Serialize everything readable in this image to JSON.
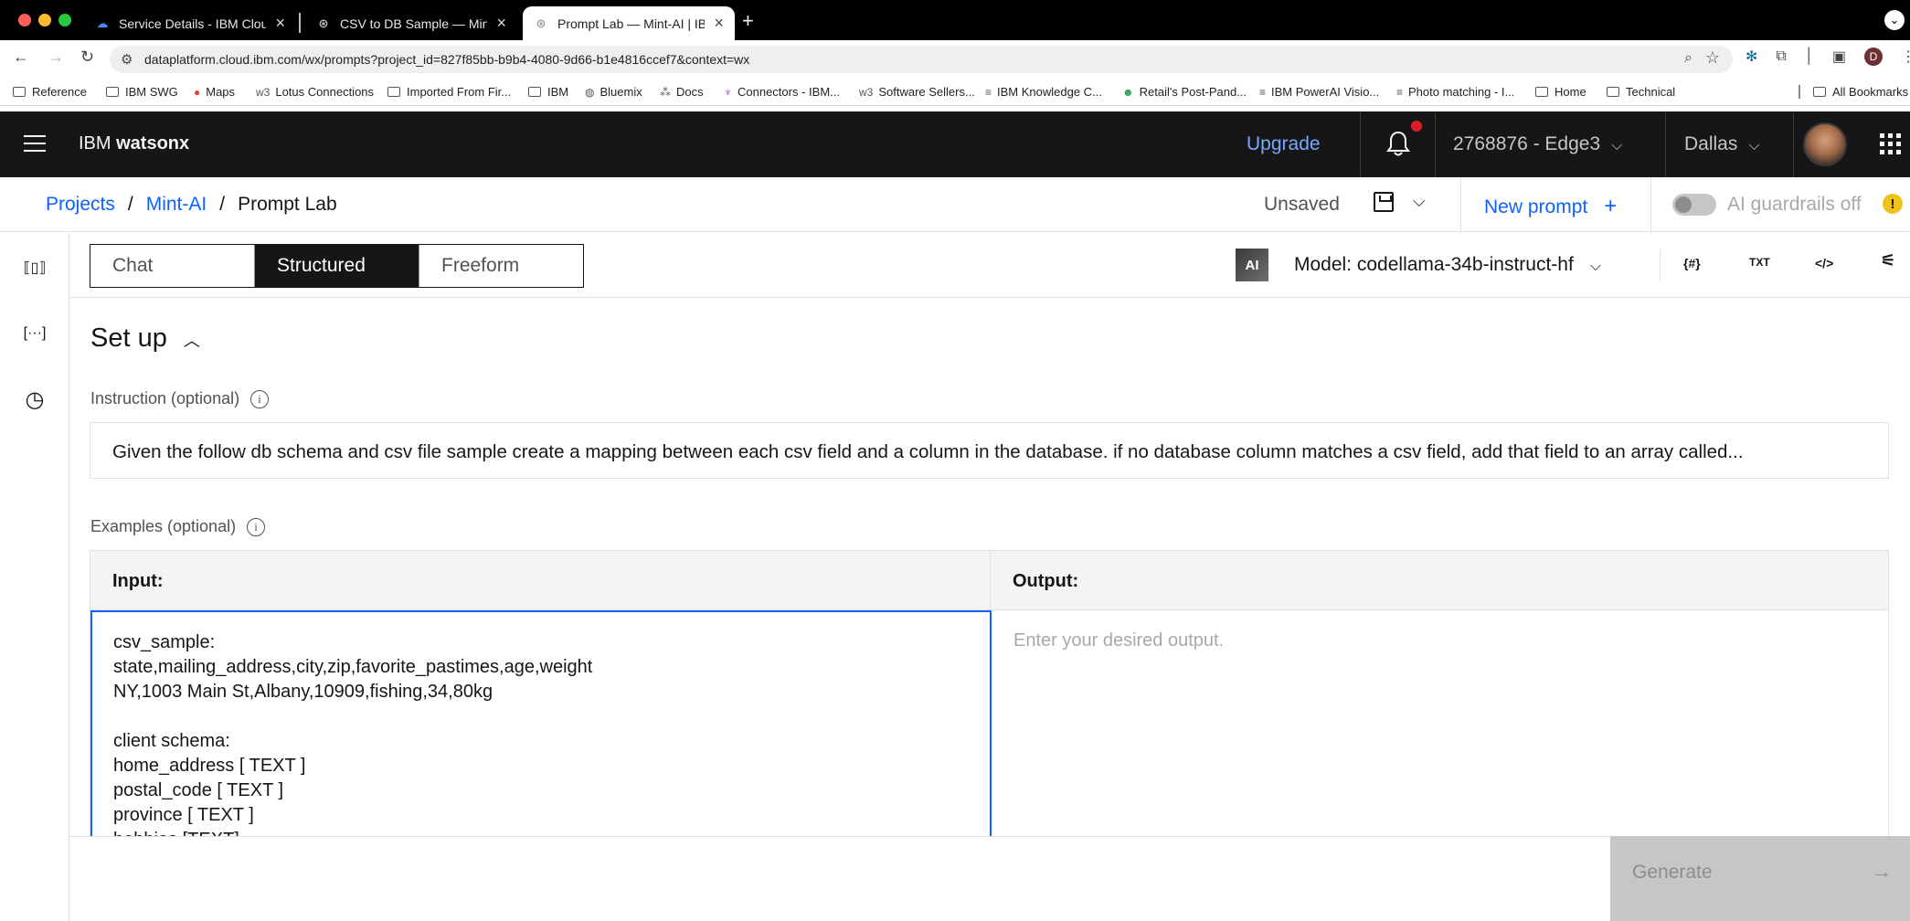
{
  "browser": {
    "tabs": [
      {
        "title": "Service Details - IBM Cloud",
        "icon": "cloud-icon"
      },
      {
        "title": "CSV to DB Sample — Mint-AI",
        "icon": "watsonx-icon"
      },
      {
        "title": "Prompt Lab — Mint-AI | IBM w",
        "icon": "watsonx-icon",
        "active": true
      }
    ],
    "url": "dataplatform.cloud.ibm.com/wx/prompts?project_id=827f85bb-b9b4-4080-9d66-b1e4816ccef7&context=wx",
    "profile_initial": "D",
    "bookmarks": [
      "Reference",
      "IBM SWG",
      "Maps",
      "Lotus Connections",
      "Imported From Fir...",
      "IBM",
      "Bluemix",
      "Docs",
      "Connectors - IBM...",
      "Software Sellers...",
      "IBM Knowledge C...",
      "Retail's Post-Pand...",
      "IBM PowerAI Visio...",
      "Photo matching - I...",
      "Home",
      "Technical",
      "All Bookmarks"
    ]
  },
  "header": {
    "brand_prefix": "IBM",
    "brand_name": "watsonx",
    "upgrade": "Upgrade",
    "account": "2768876 - Edge3",
    "region": "Dallas"
  },
  "breadcrumb": {
    "items": [
      "Projects",
      "Mint-AI",
      "Prompt Lab"
    ],
    "separator": "/"
  },
  "actions": {
    "status": "Unsaved",
    "new_prompt": "New prompt",
    "guardrails": "AI guardrails off",
    "guardrails_on": false
  },
  "modes": {
    "items": [
      "Chat",
      "Structured",
      "Freeform"
    ],
    "selected": "Structured"
  },
  "model": {
    "badge": "AI",
    "label": "Model: codellama-34b-instruct-hf"
  },
  "tool_icons": [
    "{#}",
    "TXT",
    "</>"
  ],
  "setup": {
    "title": "Set up",
    "instruction_label": "Instruction (optional)",
    "instruction_text": "Given the follow db schema and csv file sample create a mapping between each csv field and a column in the database. if no database column matches a csv field, add that field to an array called...",
    "examples_label": "Examples (optional)",
    "input_header": "Input:",
    "output_header": "Output:",
    "input_text": "csv_sample:\nstate,mailing_address,city,zip,favorite_pastimes,age,weight\nNY,1003 Main St,Albany,10909,fishing,34,80kg\n\nclient schema:\nhome_address [ TEXT ]\npostal_code [ TEXT ]\nprovince [ TEXT ]\nhobbies [TEXT]",
    "output_placeholder": "Enter your desired output."
  },
  "footer": {
    "generate": "Generate"
  },
  "colors": {
    "ibm_blue": "#0f62fe",
    "header_bg": "#161616",
    "upgrade": "#78a9ff",
    "notification": "#da1e28",
    "warning": "#f1c21b"
  }
}
